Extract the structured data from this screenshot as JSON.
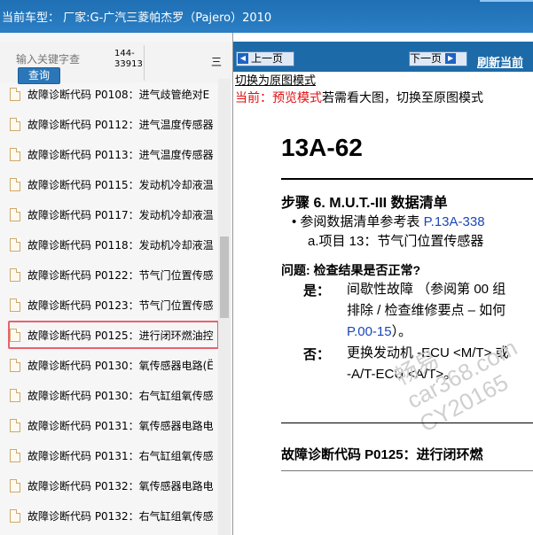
{
  "titlebar": {
    "title": "当前车型： 厂家:G-广汽三菱帕杰罗（Pajero）2010"
  },
  "search": {
    "placeholder": "输入关键字查",
    "button_label": "查询",
    "result_count": "144-33913",
    "column_mark": "三"
  },
  "list": {
    "items": [
      {
        "label": "故障诊断代码 P0108：进气歧管绝对E"
      },
      {
        "label": "故障诊断代码 P0112：进气温度传感器"
      },
      {
        "label": "故障诊断代码 P0113：进气温度传感器"
      },
      {
        "label": "故障诊断代码 P0115：发动机冷却液温"
      },
      {
        "label": "故障诊断代码 P0117：发动机冷却液温"
      },
      {
        "label": "故障诊断代码 P0118：发动机冷却液温"
      },
      {
        "label": "故障诊断代码 P0122：节气门位置传感"
      },
      {
        "label": "故障诊断代码 P0123：节气门位置传感"
      },
      {
        "label": "故障诊断代码 P0125：进行闭环燃油控"
      },
      {
        "label": "故障诊断代码 P0130：氧传感器电路(Ё"
      },
      {
        "label": "故障诊断代码 P0130：右气缸组氧传感"
      },
      {
        "label": "故障诊断代码 P0131：氧传感器电路电"
      },
      {
        "label": "故障诊断代码 P0131：右气缸组氧传感"
      },
      {
        "label": "故障诊断代码 P0132：氧传感器电路电"
      },
      {
        "label": "故障诊断代码 P0132：右气缸组氧传感"
      }
    ],
    "selected_index": 8
  },
  "nav": {
    "prev_label": "上一页",
    "next_label": "下一页",
    "refresh_label": "刷新当前"
  },
  "mode": {
    "switch_link": "切换为原图模式",
    "current_prefix": "当前：",
    "current_mode": "预览模式",
    "hint": "若需看大图，切换至原图模式"
  },
  "document": {
    "page_number": "13A-62",
    "step_title": "步骤 6. M.U.T.-III 数据清单",
    "bullet_prefix": "• 参阅数据清单参考表 ",
    "bullet_ref": "P.13A-338",
    "item_a": "a.项目 13：节气门位置传感器",
    "question": "问题: 检查结果是否正常?",
    "yes_label": "是：",
    "yes_line1": "间歇性故障 （参阅第 00 组",
    "yes_line2": "排除 / 检查维修要点 – 如何",
    "yes_line3_ref": "P.00-15",
    "yes_line3_tail": "）。",
    "no_label": "否：",
    "no_line1": "更换发动机 -ECU <M/T> 或",
    "no_line2": "-A/T-ECU <A/T>。",
    "bottom_title": "故障诊断代码 P0125：进行闭环燃",
    "watermark_line1": "畅易",
    "watermark_line2": "car368.com",
    "watermark_line3": "CY20165"
  }
}
